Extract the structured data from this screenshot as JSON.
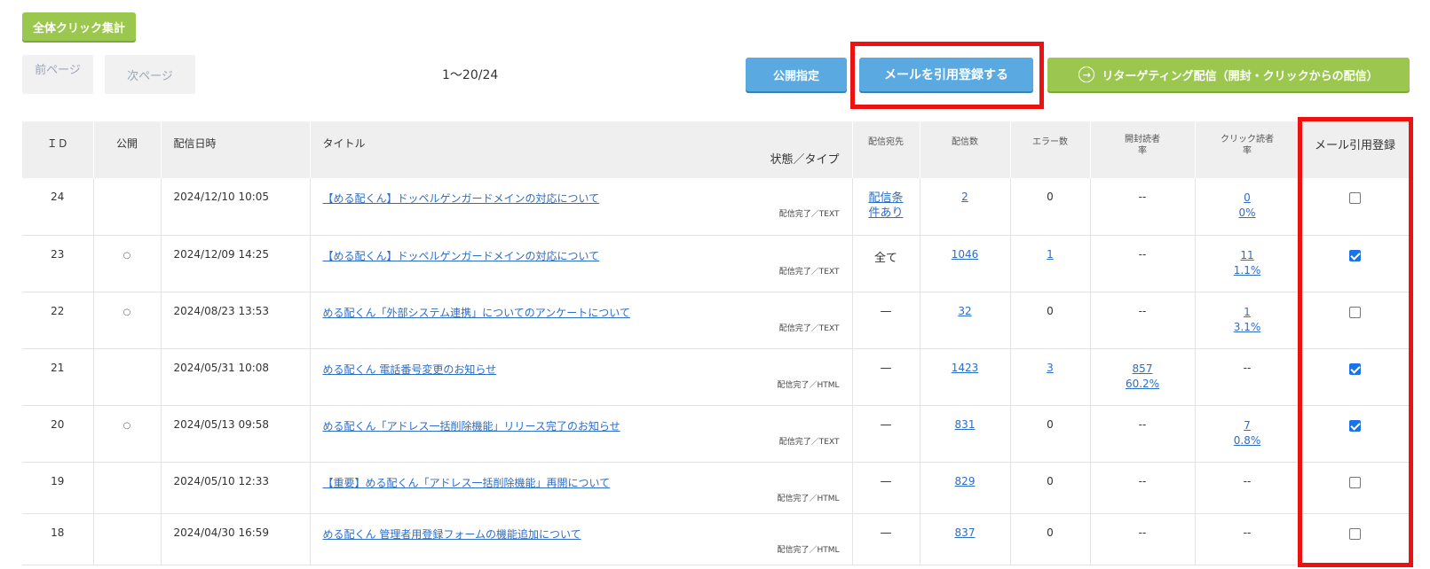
{
  "toolbar": {
    "total_clicks": "全体クリック集計",
    "prev_page": "前ページ",
    "next_page": "次ページ",
    "page_range": "1～20/24",
    "publish_setting": "公開指定",
    "quote_register": "メールを引用登録する",
    "retargeting": "リターゲティング配信（開封・クリックからの配信）"
  },
  "icons": {
    "retarget": "circle-arrow-right-icon"
  },
  "colors": {
    "green": "#9cc74f",
    "blue": "#5aa9e0",
    "highlight": "#ee1111",
    "link": "#2e6dc6"
  },
  "table": {
    "headers": {
      "id": "ＩＤ",
      "public": "公開",
      "date": "配信日時",
      "title": "タイトル",
      "type": "状態／タイプ",
      "dest": "配信宛先",
      "count": "配信数",
      "errors": "エラー数",
      "open_rate_1": "開封読者",
      "open_rate_2": "率",
      "click_rate_1": "クリック読者",
      "click_rate_2": "率",
      "quote": "メール引用登録"
    },
    "rows": [
      {
        "id": "24",
        "public": "",
        "date": "2024/12/10 10:05",
        "title": "【める配くん】ドッペルゲンガードメインの対応について",
        "type": "配信完了／TEXT",
        "dest1": "配信条",
        "dest2": "件あり",
        "dest_link": true,
        "count": "2",
        "errors": "0",
        "errors_link": false,
        "open1": "--",
        "open2": "",
        "open_link": false,
        "click1": "0",
        "click2": "0%",
        "click_link": true,
        "checked": false
      },
      {
        "id": "23",
        "public": "○",
        "date": "2024/12/09 14:25",
        "title": "【める配くん】ドッペルゲンガードメインの対応について",
        "type": "配信完了／TEXT",
        "dest1": "全て",
        "dest2": "",
        "dest_link": false,
        "count": "1046",
        "errors": "1",
        "errors_link": true,
        "open1": "--",
        "open2": "",
        "open_link": false,
        "click1": "11",
        "click2": "1.1%",
        "click_link": true,
        "checked": true
      },
      {
        "id": "22",
        "public": "○",
        "date": "2024/08/23 13:53",
        "title": "める配くん「外部システム連携」についてのアンケートについて",
        "type": "配信完了／TEXT",
        "dest1": "—",
        "dest2": "",
        "dest_link": false,
        "count": "32",
        "errors": "0",
        "errors_link": false,
        "open1": "--",
        "open2": "",
        "open_link": false,
        "click1": "1",
        "click2": "3.1%",
        "click_link": true,
        "checked": false
      },
      {
        "id": "21",
        "public": "",
        "date": "2024/05/31 10:08",
        "title": "める配くん 電話番号変更のお知らせ",
        "type": "配信完了／HTML",
        "dest1": "—",
        "dest2": "",
        "dest_link": false,
        "count": "1423",
        "errors": "3",
        "errors_link": true,
        "open1": "857",
        "open2": "60.2%",
        "open_link": true,
        "click1": "--",
        "click2": "",
        "click_link": false,
        "checked": true
      },
      {
        "id": "20",
        "public": "○",
        "date": "2024/05/13 09:58",
        "title": "める配くん「アドレス一括削除機能」リリース完了のお知らせ",
        "type": "配信完了／TEXT",
        "dest1": "—",
        "dest2": "",
        "dest_link": false,
        "count": "831",
        "errors": "0",
        "errors_link": false,
        "open1": "--",
        "open2": "",
        "open_link": false,
        "click1": "7",
        "click2": "0.8%",
        "click_link": true,
        "checked": true
      },
      {
        "id": "19",
        "public": "",
        "date": "2024/05/10 12:33",
        "title": "【重要】める配くん「アドレス一括削除機能」再開について",
        "type": "配信完了／HTML",
        "dest1": "—",
        "dest2": "",
        "dest_link": false,
        "count": "829",
        "errors": "0",
        "errors_link": false,
        "open1": "--",
        "open2": "",
        "open_link": false,
        "click1": "--",
        "click2": "",
        "click_link": false,
        "checked": false
      },
      {
        "id": "18",
        "public": "",
        "date": "2024/04/30 16:59",
        "title": "める配くん 管理者用登録フォームの機能追加について",
        "type": "配信完了／HTML",
        "dest1": "—",
        "dest2": "",
        "dest_link": false,
        "count": "837",
        "errors": "0",
        "errors_link": false,
        "open1": "--",
        "open2": "",
        "open_link": false,
        "click1": "--",
        "click2": "",
        "click_link": false,
        "checked": false
      }
    ]
  }
}
